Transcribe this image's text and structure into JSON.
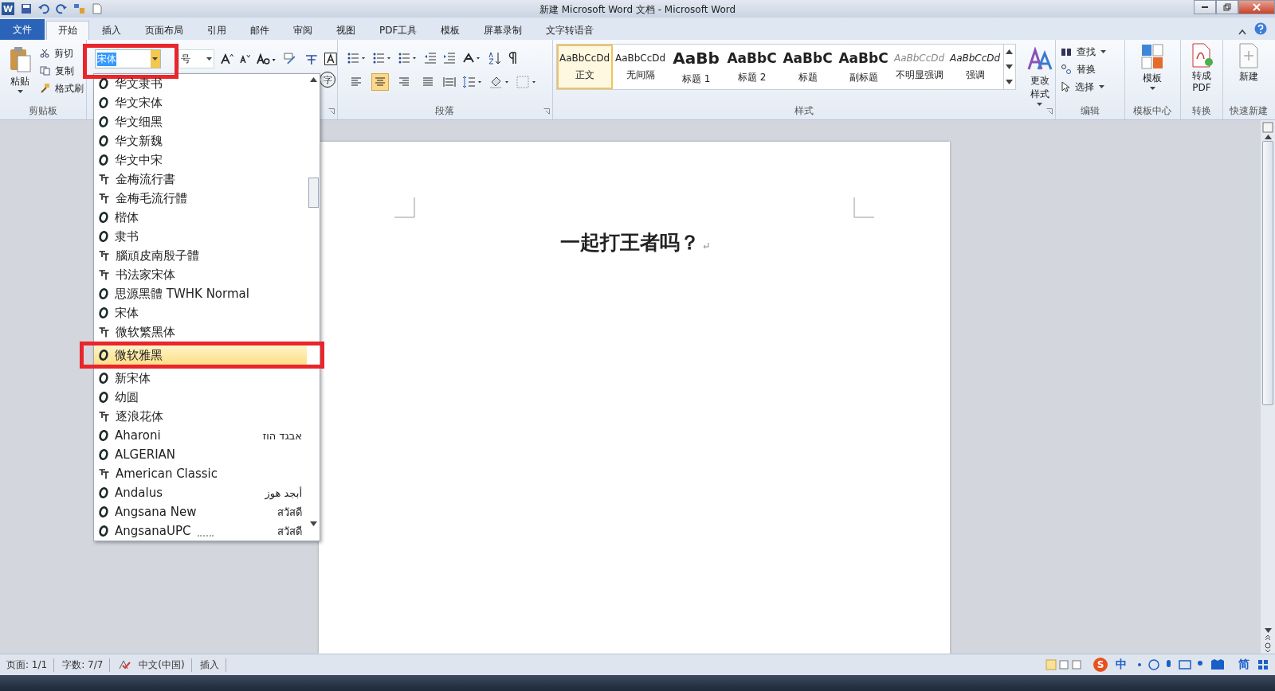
{
  "window": {
    "title": "新建 Microsoft Word 文档 - Microsoft Word",
    "app_icon": "W"
  },
  "tabs": [
    {
      "label": "文件",
      "kind": "file",
      "selected": false
    },
    {
      "label": "开始",
      "kind": "tab",
      "selected": true
    },
    {
      "label": "插入",
      "kind": "tab",
      "selected": false
    },
    {
      "label": "页面布局",
      "kind": "tab",
      "selected": false
    },
    {
      "label": "引用",
      "kind": "tab",
      "selected": false
    },
    {
      "label": "邮件",
      "kind": "tab",
      "selected": false
    },
    {
      "label": "审阅",
      "kind": "tab",
      "selected": false
    },
    {
      "label": "视图",
      "kind": "tab",
      "selected": false
    },
    {
      "label": "PDF工具",
      "kind": "tab",
      "selected": false
    },
    {
      "label": "模板",
      "kind": "tab",
      "selected": false
    },
    {
      "label": "屏幕录制",
      "kind": "tab",
      "selected": false
    },
    {
      "label": "文字转语音",
      "kind": "tab",
      "selected": false
    }
  ],
  "clipboard": {
    "paste": "粘贴",
    "cut": "剪切",
    "copy": "复制",
    "format_painter": "格式刷",
    "label": "剪贴板"
  },
  "font": {
    "font_name": "宋体",
    "font_size": "号",
    "enclose_char": "字"
  },
  "paragraph": {
    "label": "段落"
  },
  "styles": {
    "label": "样式",
    "change_styles": "更改样式",
    "items": [
      {
        "preview": "AaBbCcDd",
        "name": "正文",
        "kind": "normal",
        "selected": true
      },
      {
        "preview": "AaBbCcDd",
        "name": "无间隔",
        "kind": "normal",
        "selected": false
      },
      {
        "preview": "AaBb",
        "name": "标题 1",
        "kind": "heading1",
        "selected": false
      },
      {
        "preview": "AaBbC",
        "name": "标题 2",
        "kind": "heading2",
        "selected": false
      },
      {
        "preview": "AaBbC",
        "name": "标题",
        "kind": "heading2",
        "selected": false
      },
      {
        "preview": "AaBbC",
        "name": "副标题",
        "kind": "heading2",
        "selected": false
      },
      {
        "preview": "AaBbCcDd",
        "name": "不明显强调",
        "kind": "subtle",
        "selected": false
      },
      {
        "preview": "AaBbCcDd",
        "name": "强调",
        "kind": "emphasis",
        "selected": false
      }
    ]
  },
  "editing": {
    "label": "编辑",
    "find": "查找",
    "replace": "替换",
    "select": "选择"
  },
  "template": {
    "button": "模板",
    "label": "模板中心"
  },
  "convert": {
    "button": "转成PDF",
    "label": "转换"
  },
  "quick_new": {
    "button": "新建",
    "label": "快速新建"
  },
  "font_list": [
    {
      "name": "华文隶书",
      "kind": "opentype",
      "selected": false
    },
    {
      "name": "华文宋体",
      "kind": "opentype",
      "selected": false
    },
    {
      "name": "华文细黑",
      "kind": "opentype",
      "selected": false
    },
    {
      "name": "华文新魏",
      "kind": "opentype",
      "selected": false
    },
    {
      "name": "华文中宋",
      "kind": "opentype",
      "selected": false
    },
    {
      "name": "金梅流行書",
      "kind": "truetype",
      "selected": false
    },
    {
      "name": "金梅毛流行體",
      "kind": "truetype",
      "selected": false
    },
    {
      "name": "楷体",
      "kind": "opentype",
      "selected": false
    },
    {
      "name": "隶书",
      "kind": "opentype",
      "selected": false
    },
    {
      "name": "腦頑皮南殷子體",
      "kind": "truetype",
      "selected": false
    },
    {
      "name": "书法家宋体",
      "kind": "truetype",
      "selected": false
    },
    {
      "name": "思源黑體 TWHK Normal",
      "kind": "opentype",
      "selected": false
    },
    {
      "name": "宋体",
      "kind": "opentype",
      "selected": false
    },
    {
      "name": "微软繁黑体",
      "kind": "truetype",
      "selected": false
    },
    {
      "name": "微软雅黑",
      "kind": "opentype",
      "selected": true
    },
    {
      "name": "新宋体",
      "kind": "opentype",
      "selected": false
    },
    {
      "name": "幼圆",
      "kind": "opentype",
      "selected": false
    },
    {
      "name": "逐浪花体",
      "kind": "truetype",
      "selected": false
    },
    {
      "name": "Aharoni",
      "kind": "opentype",
      "sample": "אבגד הוז",
      "selected": false
    },
    {
      "name": "ALGERIAN",
      "kind": "opentype",
      "selected": false
    },
    {
      "name": "American Classic",
      "kind": "truetype",
      "selected": false
    },
    {
      "name": "Andalus",
      "kind": "opentype",
      "sample": "أبجد هوز",
      "selected": false
    },
    {
      "name": "Angsana New",
      "kind": "opentype",
      "sample": "สวัสดี",
      "selected": false
    },
    {
      "name": "AngsanaUPC",
      "kind": "opentype",
      "sample": "สวัสดี",
      "selected": false
    }
  ],
  "document": {
    "text": "一起打王者吗？"
  },
  "status_bar": [
    {
      "label": "页面: 1/1"
    },
    {
      "label": "字数: 7/7"
    },
    {
      "label": "中文(中国)"
    },
    {
      "label": "插入"
    }
  ],
  "ime": {
    "logo": "S",
    "mode": "中",
    "script": "简"
  }
}
